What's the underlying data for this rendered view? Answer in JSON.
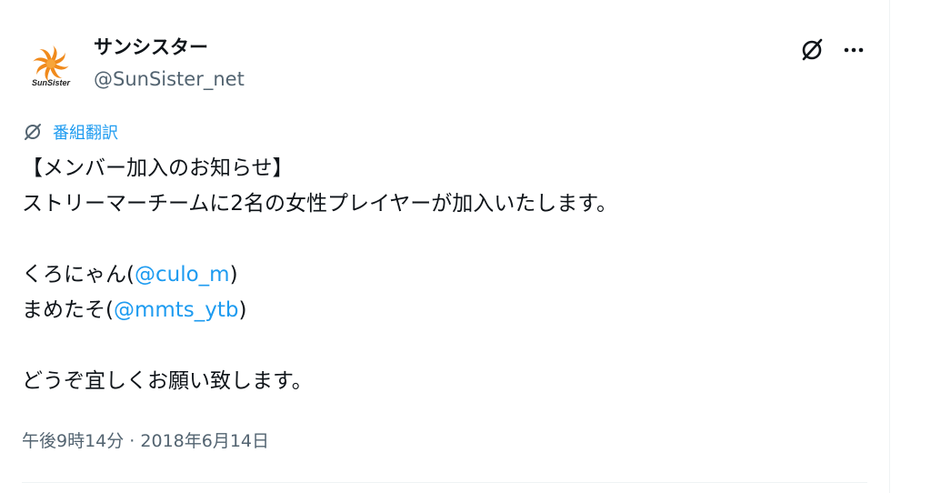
{
  "author": {
    "display_name": "サンシスター",
    "handle": "@SunSister_net",
    "avatar_text": "SunSister"
  },
  "icons": {
    "grok": "grok-icon",
    "more": "more-dots-icon",
    "translate": "grok-translate-icon",
    "avatar": "sun-logo-icon"
  },
  "colors": {
    "link": "#1d9bf0",
    "secondary_text": "#536471",
    "logo_orange": "#f08a1c"
  },
  "translate": {
    "label": "番組翻訳"
  },
  "tweet": {
    "line1": "【メンバー加入のお知らせ】",
    "line2": "ストリーマーチームに2名の女性プレイヤーが加入いたします。",
    "member1_name": "くろにゃん(",
    "member1_mention": "@culo_m",
    "member1_close": ")",
    "member2_name": "まめたそ(",
    "member2_mention": "@mmts_ytb",
    "member2_close": ")",
    "closing": "どうぞ宜しくお願い致します。"
  },
  "meta": {
    "time": "午後9時14分",
    "separator": " · ",
    "date": "2018年6月14日"
  }
}
